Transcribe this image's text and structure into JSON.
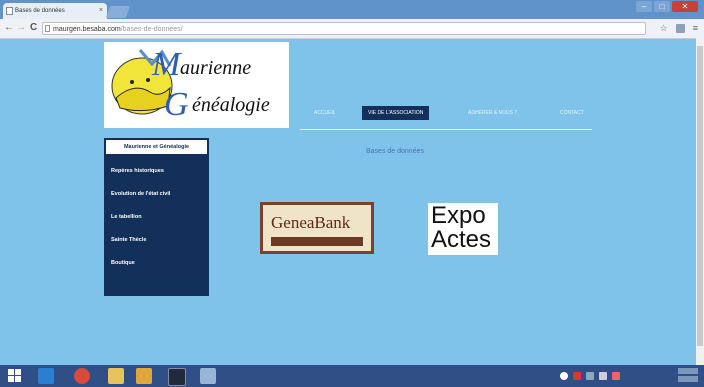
{
  "browser": {
    "tab_title": "Bases de données",
    "tab_close": "×",
    "url_host": "maurgen.besaba.com",
    "url_path": "/bases-de-donnees/",
    "nav_back": "←",
    "nav_forward": "→",
    "nav_reload": "C",
    "star_icon": "☆",
    "menu_icon": "≡",
    "window": {
      "minimize": "–",
      "maximize": "□",
      "close": "✕"
    }
  },
  "site": {
    "logo_line1": "aurienne",
    "logo_line2": "énéalogie",
    "logo_initial_m": "M",
    "logo_initial_g": "G",
    "menu": [
      {
        "label": "ACCUEIL"
      },
      {
        "label": "VIE DE L'ASSOCIATION"
      },
      {
        "label": "ADHÉRER & NOUS ?"
      },
      {
        "label": "CONTACT"
      }
    ],
    "sidebar_header": "Maurienne et Généalogie",
    "sidebar_items": [
      "Repères historiques",
      "Evolution de l'état civil",
      "Le tabellion",
      "Sainte Thècle",
      "Boutique"
    ],
    "page_title": "Bases de données",
    "geneabank_text": "GeneaBank",
    "expo_line1": "Expo",
    "expo_line2": "Actes"
  },
  "colors": {
    "page_bg": "#7fc3ea",
    "navy": "#13305a",
    "taskbar": "#2f4f86"
  }
}
